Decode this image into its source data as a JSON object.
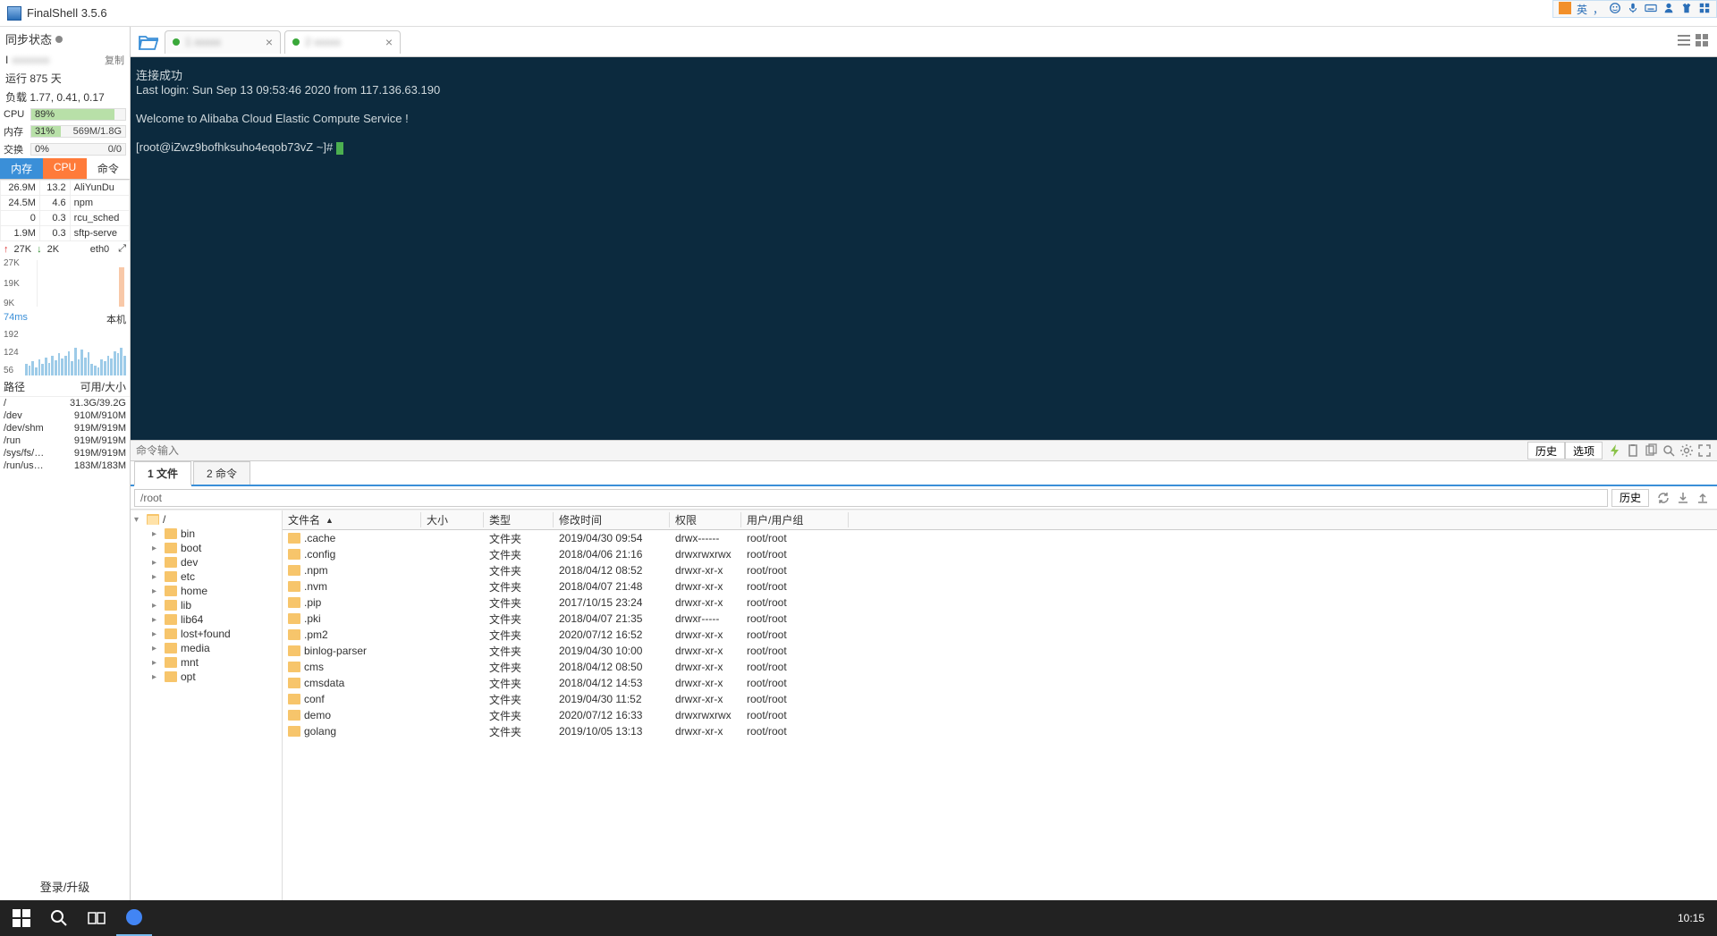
{
  "app": {
    "title": "FinalShell 3.5.6",
    "ime_lang": "英"
  },
  "sidebar": {
    "sync_label": "同步状态",
    "ip_label": "I",
    "copy_label": "复制",
    "uptime": "运行 875 天",
    "load_label": "负载 1.77, 0.41, 0.17",
    "bars": [
      {
        "label": "CPU",
        "pct": "89%",
        "value": 89,
        "right": ""
      },
      {
        "label": "内存",
        "pct": "31%",
        "value": 31,
        "right": "569M/1.8G"
      },
      {
        "label": "交换",
        "pct": "0%",
        "value": 0,
        "right": "0/0"
      }
    ],
    "proc_tabs": {
      "mem": "内存",
      "cpu": "CPU",
      "cmd": "命令"
    },
    "procs": [
      {
        "mem": "26.9M",
        "cpu": "13.2",
        "name": "AliYunDu"
      },
      {
        "mem": "24.5M",
        "cpu": "4.6",
        "name": "npm"
      },
      {
        "mem": "0",
        "cpu": "0.3",
        "name": "rcu_sched"
      },
      {
        "mem": "1.9M",
        "cpu": "0.3",
        "name": "sftp-serve"
      }
    ],
    "net": {
      "up": "27K",
      "down": "2K",
      "iface": "eth0"
    },
    "net_ticks": [
      "27K",
      "19K",
      "9K"
    ],
    "ping": {
      "val": "74ms",
      "label": "本机",
      "ticks": [
        "192",
        "124",
        "56"
      ]
    },
    "disk_hdr": {
      "path": "路径",
      "use": "可用/大小"
    },
    "disks": [
      {
        "p": "/",
        "u": "31.3G/39.2G"
      },
      {
        "p": "/dev",
        "u": "910M/910M"
      },
      {
        "p": "/dev/shm",
        "u": "919M/919M"
      },
      {
        "p": "/run",
        "u": "919M/919M"
      },
      {
        "p": "/sys/fs/…",
        "u": "919M/919M"
      },
      {
        "p": "/run/us…",
        "u": "183M/183M"
      }
    ],
    "login": "登录/升级"
  },
  "tabs": [
    {
      "label": "1",
      "active": false
    },
    {
      "label": "2",
      "active": true
    }
  ],
  "terminal": {
    "lines": [
      "连接成功",
      "Last login: Sun Sep 13 09:53:46 2020 from 117.136.63.190",
      "",
      "Welcome to Alibaba Cloud Elastic Compute Service !",
      "",
      "[root@iZwz9bofhksuho4eqob73vZ ~]# "
    ]
  },
  "cmdbar": {
    "placeholder": "命令输入",
    "history": "历史",
    "options": "选项"
  },
  "bottom_tabs": {
    "files": "1 文件",
    "cmds": "2 命令"
  },
  "pathbar": {
    "path": "/root",
    "history": "历史"
  },
  "tree_root": "/",
  "tree": [
    "bin",
    "boot",
    "dev",
    "etc",
    "home",
    "lib",
    "lib64",
    "lost+found",
    "media",
    "mnt",
    "opt"
  ],
  "file_cols": {
    "name": "文件名",
    "size": "大小",
    "type": "类型",
    "mtime": "修改时间",
    "perm": "权限",
    "owner": "用户/用户组"
  },
  "files": [
    {
      "n": ".cache",
      "t": "文件夹",
      "m": "2019/04/30 09:54",
      "p": "drwx------",
      "o": "root/root"
    },
    {
      "n": ".config",
      "t": "文件夹",
      "m": "2018/04/06 21:16",
      "p": "drwxrwxrwx",
      "o": "root/root"
    },
    {
      "n": ".npm",
      "t": "文件夹",
      "m": "2018/04/12 08:52",
      "p": "drwxr-xr-x",
      "o": "root/root"
    },
    {
      "n": ".nvm",
      "t": "文件夹",
      "m": "2018/04/07 21:48",
      "p": "drwxr-xr-x",
      "o": "root/root"
    },
    {
      "n": ".pip",
      "t": "文件夹",
      "m": "2017/10/15 23:24",
      "p": "drwxr-xr-x",
      "o": "root/root"
    },
    {
      "n": ".pki",
      "t": "文件夹",
      "m": "2018/04/07 21:35",
      "p": "drwxr-----",
      "o": "root/root"
    },
    {
      "n": ".pm2",
      "t": "文件夹",
      "m": "2020/07/12 16:52",
      "p": "drwxr-xr-x",
      "o": "root/root"
    },
    {
      "n": "binlog-parser",
      "t": "文件夹",
      "m": "2019/04/30 10:00",
      "p": "drwxr-xr-x",
      "o": "root/root"
    },
    {
      "n": "cms",
      "t": "文件夹",
      "m": "2018/04/12 08:50",
      "p": "drwxr-xr-x",
      "o": "root/root"
    },
    {
      "n": "cmsdata",
      "t": "文件夹",
      "m": "2018/04/12 14:53",
      "p": "drwxr-xr-x",
      "o": "root/root"
    },
    {
      "n": "conf",
      "t": "文件夹",
      "m": "2019/04/30 11:52",
      "p": "drwxr-xr-x",
      "o": "root/root"
    },
    {
      "n": "demo",
      "t": "文件夹",
      "m": "2020/07/12 16:33",
      "p": "drwxrwxrwx",
      "o": "root/root"
    },
    {
      "n": "golang",
      "t": "文件夹",
      "m": "2019/10/05 13:13",
      "p": "drwxr-xr-x",
      "o": "root/root"
    }
  ],
  "taskbar": {
    "clock": "10:15"
  }
}
